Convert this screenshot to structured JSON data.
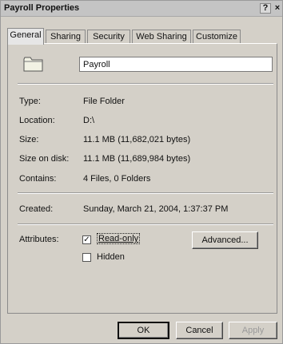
{
  "window": {
    "title": "Payroll Properties",
    "help_label": "?",
    "close_label": "×"
  },
  "tabs": [
    {
      "label": "General",
      "active": true
    },
    {
      "label": "Sharing",
      "active": false
    },
    {
      "label": "Security",
      "active": false
    },
    {
      "label": "Web Sharing",
      "active": false
    },
    {
      "label": "Customize",
      "active": false
    }
  ],
  "general": {
    "folder_icon": "folder-icon",
    "name": "Payroll",
    "type_label": "Type:",
    "type_value": "File Folder",
    "location_label": "Location:",
    "location_value": "D:\\",
    "size_label": "Size:",
    "size_value": "11.1 MB (11,682,021 bytes)",
    "size_on_disk_label": "Size on disk:",
    "size_on_disk_value": "11.1 MB (11,689,984 bytes)",
    "contains_label": "Contains:",
    "contains_value": "4 Files, 0 Folders",
    "created_label": "Created:",
    "created_value": "Sunday, March 21, 2004, 1:37:37 PM",
    "attributes_label": "Attributes:",
    "readonly_label": "Read-only",
    "readonly_checked": true,
    "hidden_label": "Hidden",
    "hidden_checked": false,
    "advanced_label": "Advanced..."
  },
  "buttons": {
    "ok": "OK",
    "cancel": "Cancel",
    "apply": "Apply"
  }
}
